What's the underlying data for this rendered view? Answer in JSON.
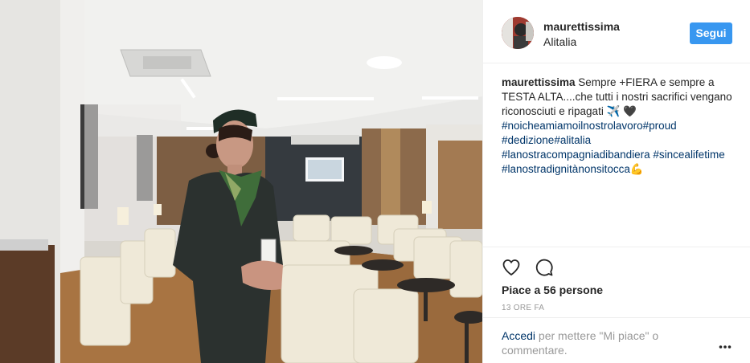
{
  "post": {
    "username": "maurettissima",
    "location": "Alitalia",
    "follow_label": "Segui",
    "caption": {
      "username": "maurettissima",
      "segments": [
        {
          "type": "text",
          "value": " Sempre +FIERA e sempre a TESTA ALTA....che tutti i nostri sacrifici vengano riconosciuti e ripagati ✈️ "
        },
        {
          "type": "text",
          "value": "🖤"
        },
        {
          "type": "tag",
          "value": "#noicheamiamoilnostrolavoro"
        },
        {
          "type": "tag",
          "value": "#proud"
        },
        {
          "type": "text",
          "value": " "
        },
        {
          "type": "tag",
          "value": "#dedizione"
        },
        {
          "type": "tag",
          "value": "#alitalia"
        },
        {
          "type": "text",
          "value": " "
        },
        {
          "type": "tag",
          "value": "#lanostracompagniadibandiera"
        },
        {
          "type": "text",
          "value": " "
        },
        {
          "type": "tag",
          "value": "#sincealifetime"
        },
        {
          "type": "text",
          "value": " "
        },
        {
          "type": "tag",
          "value": "#lanostradignitànonsitocca"
        },
        {
          "type": "text",
          "value": "💪"
        }
      ]
    },
    "likes_text": "Piace a 56 persone",
    "time_text": "13 ORE FA",
    "login_link": "Accedi",
    "login_rest": " per mettere \"Mi piace\" o commentare.",
    "icons": {
      "like": "heart-outline-icon",
      "comment": "speech-bubble-icon",
      "more": "more-options-icon"
    }
  },
  "colors": {
    "follow_button": "#3897f0",
    "hashtag": "#003569",
    "muted": "#999999",
    "text": "#262626"
  }
}
